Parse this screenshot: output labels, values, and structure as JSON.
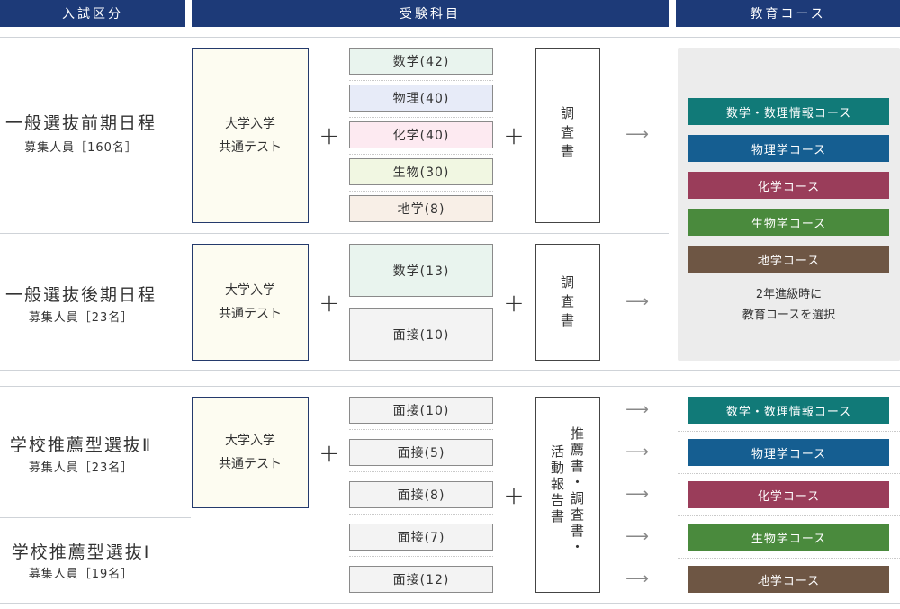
{
  "header": {
    "col_category": "入試区分",
    "col_subjects": "受験科目",
    "col_course": "教育コース"
  },
  "general": {
    "common_test": "大学入学\n共通テスト",
    "early": {
      "title": "一般選抜前期日程",
      "sub": "募集人員［160名］",
      "subjects": [
        "数学(42)",
        "物理(40)",
        "化学(40)",
        "生物(30)",
        "地学(8)"
      ],
      "doc": "調査書"
    },
    "late": {
      "title": "一般選抜後期日程",
      "sub": "募集人員［23名］",
      "subjects": [
        "数学(13)",
        "面接(10)"
      ],
      "doc": "調査書"
    },
    "courses": [
      "数学・数理情報コース",
      "物理学コース",
      "化学コース",
      "生物学コース",
      "地学コース"
    ],
    "note": "2年進級時に\n教育コースを選択"
  },
  "school": {
    "common_test": "大学入学\n共通テスト",
    "rec2": {
      "title": "学校推薦型選抜Ⅱ",
      "sub": "募集人員［23名］"
    },
    "rec1": {
      "title": "学校推薦型選抜Ⅰ",
      "sub": "募集人員［19名］"
    },
    "subjects": [
      "面接(10)",
      "面接(5)",
      "面接(8)",
      "面接(7)",
      "面接(12)"
    ],
    "doc_col1": "推薦書・調査書・",
    "doc_col2": "活動報告書",
    "courses": [
      "数学・数理情報コース",
      "物理学コース",
      "化学コース",
      "生物学コース",
      "地学コース"
    ]
  },
  "symbols": {
    "plus": "+",
    "arrow": "⟶"
  },
  "colors": {
    "header_bg": "#1d3a78",
    "course_math": "#117a78",
    "course_phys": "#155e91",
    "course_chem": "#9a3d5a",
    "course_bio": "#4a8a3d",
    "course_geo": "#6e5644",
    "subj_math": "#e9f4ee",
    "subj_phys": "#e7ebf8",
    "subj_chem": "#fdeaf1",
    "subj_bio": "#f1f7e2",
    "subj_geo": "#f8efe7",
    "subj_interview": "#f3f3f3"
  }
}
